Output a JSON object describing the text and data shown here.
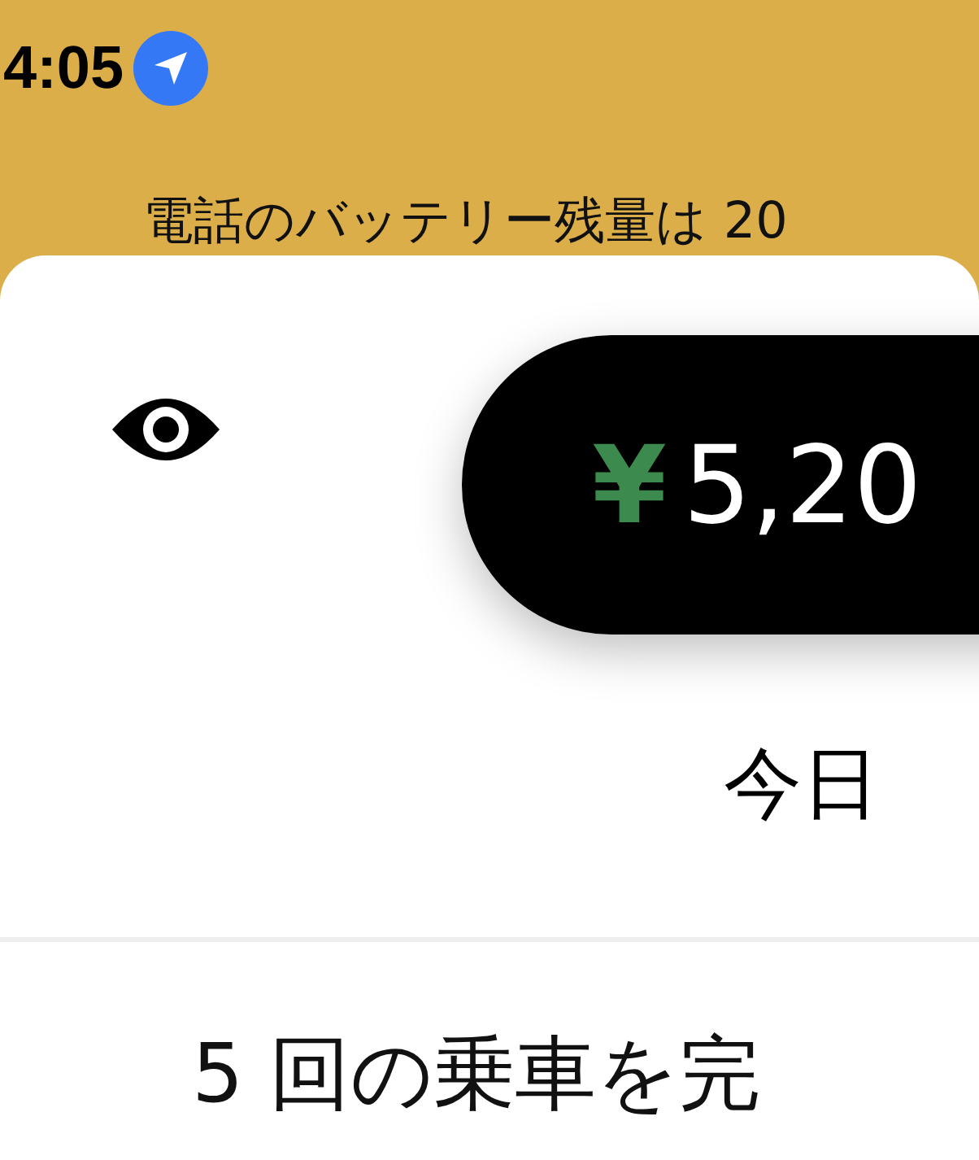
{
  "status_bar": {
    "time": "4:05",
    "location_active": true
  },
  "notification": {
    "text": "電話のバッテリー残量は 20"
  },
  "earnings": {
    "visible": true,
    "currency": "¥",
    "amount": "5,20",
    "period": "今日"
  },
  "trips": {
    "text": "5 回の乗車を完"
  }
}
